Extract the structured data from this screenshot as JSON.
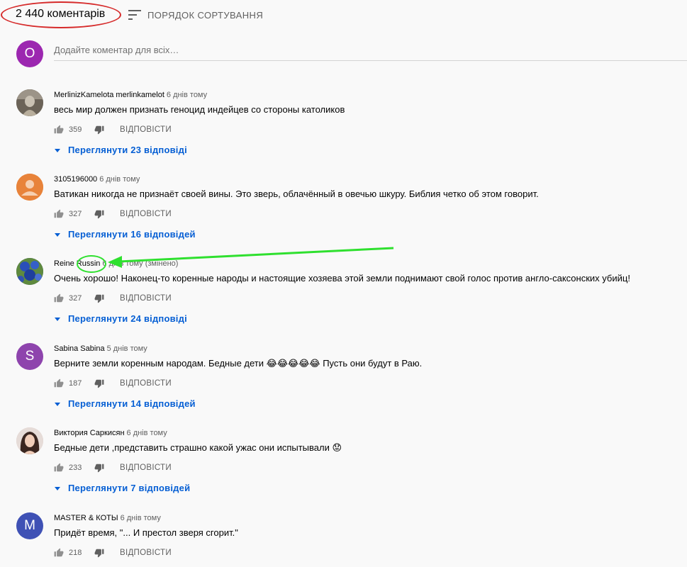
{
  "header": {
    "comment_count": "2 440 коментарів",
    "sort_label": "ПОРЯДОК СОРТУВАННЯ"
  },
  "add_comment": {
    "avatar_letter": "O",
    "avatar_color": "#9c27b0",
    "placeholder": "Додайте коментар для всіх…"
  },
  "labels": {
    "reply": "ВІДПОВІСТИ"
  },
  "colors": {
    "accent_link": "#065fd4",
    "annotation_red": "#d62b2b",
    "annotation_green": "#2fe02f"
  },
  "comments": [
    {
      "author": "MerlinizKamelota merlinkamelot",
      "time": "6 днів тому",
      "text": "весь мир должен признать  геноцид индейцев  со стороны католиков",
      "likes": "359",
      "replies_label": "Переглянути 23 відповіді",
      "avatar_icon": "photo-avatar-statue"
    },
    {
      "author": "3105196000",
      "time": "6 днів тому",
      "text": "Ватикан никогда не признаёт своей вины. Это зверь, облачённый в овечью шкуру. Библия четко об этом говорит.",
      "likes": "327",
      "replies_label": "Переглянути 16 відповідей",
      "avatar_icon": "default-user-avatar"
    },
    {
      "author": "Reine Russin",
      "time": "6 днів тому (змінено)",
      "text": "Очень хорошо! Наконец-то коренные народы и настоящие хозяева этой земли  поднимают свой голос против англо-саксонских  убийц!",
      "likes": "327",
      "replies_label": "Переглянути 24 відповіді",
      "avatar_icon": "photo-avatar-flowers"
    },
    {
      "author": "Sabina Sabina",
      "time": "5 днів тому",
      "text": "Верните земли коренным народам. Бедные дети 😂😂😂😂😂 Пусть они будут в Раю.",
      "likes": "187",
      "replies_label": "Переглянути 14 відповідей",
      "avatar_letter": "S",
      "avatar_color": "#8e44ad"
    },
    {
      "author": "Виктория Саркисян",
      "time": "6 днів тому",
      "text": "Бедные дети ,представить страшно какой ужас они испытывали 😟",
      "likes": "233",
      "replies_label": "Переглянути 7 відповідей",
      "avatar_icon": "photo-avatar-woman"
    },
    {
      "author": "MASTER & КОТЫ",
      "time": "6 днів тому",
      "text": "Придёт время, \"... И престол зверя сгорит.\"",
      "likes": "218",
      "avatar_letter": "M",
      "avatar_color": "#3f51b5"
    }
  ]
}
